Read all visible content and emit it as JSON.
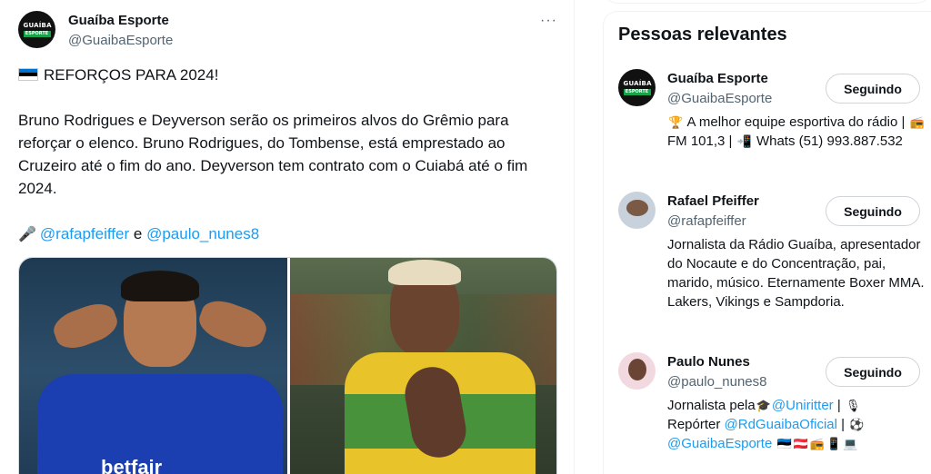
{
  "tweet": {
    "author_name": "Guaíba Esporte",
    "author_handle": "@GuaibaEsporte",
    "logo_text_top": "GUAÍBA",
    "logo_text_bottom": "ESPORTE",
    "headline": "REFORÇOS PARA 2024!",
    "body": "Bruno Rodrigues e Deyverson serão os primeiros alvos do Grêmio para reforçar o elenco. Bruno Rodrigues, do Tombense, está emprestado ao Cruzeiro até o fim do ano. Deyverson tem contrato com o Cuiabá até o fim 2024.",
    "mention_1": "@rafapfeiffer",
    "connector": "e",
    "mention_2": "@paulo_nunes8",
    "more_label": "···",
    "image_caption_left": "betfair"
  },
  "sidebar": {
    "title": "Pessoas relevantes",
    "people": [
      {
        "name": "Guaíba Esporte",
        "handle": "@GuaibaEsporte",
        "button": "Seguindo",
        "bio_1": "A melhor equipe esportiva do rádio",
        "bio_2": "| ",
        "bio_3": "FM 101,3 | ",
        "bio_4": "Whats (51) 993.887.532"
      },
      {
        "name": "Rafael Pfeiffer",
        "handle": "@rafapfeiffer",
        "button": "Seguindo",
        "bio": "Jornalista da Rádio Guaíba, apresentador do Nocaute e do Concentração, pai, marido, músico. Eternamente Boxer MMA. Lakers, Vikings e Sampdoria."
      },
      {
        "name": "Paulo Nunes",
        "handle": "@paulo_nunes8",
        "button": "Seguindo",
        "bio_prefix": "Jornalista pela",
        "bio_link_1": "@Uniritter",
        "bio_mid": "Repórter",
        "bio_link_2": "@RdGuaibaOficial",
        "bio_link_3": "@GuaibaEsporte"
      }
    ]
  },
  "colors": {
    "link": "#1d9bf0",
    "muted": "#536471",
    "text": "#0f1419"
  }
}
